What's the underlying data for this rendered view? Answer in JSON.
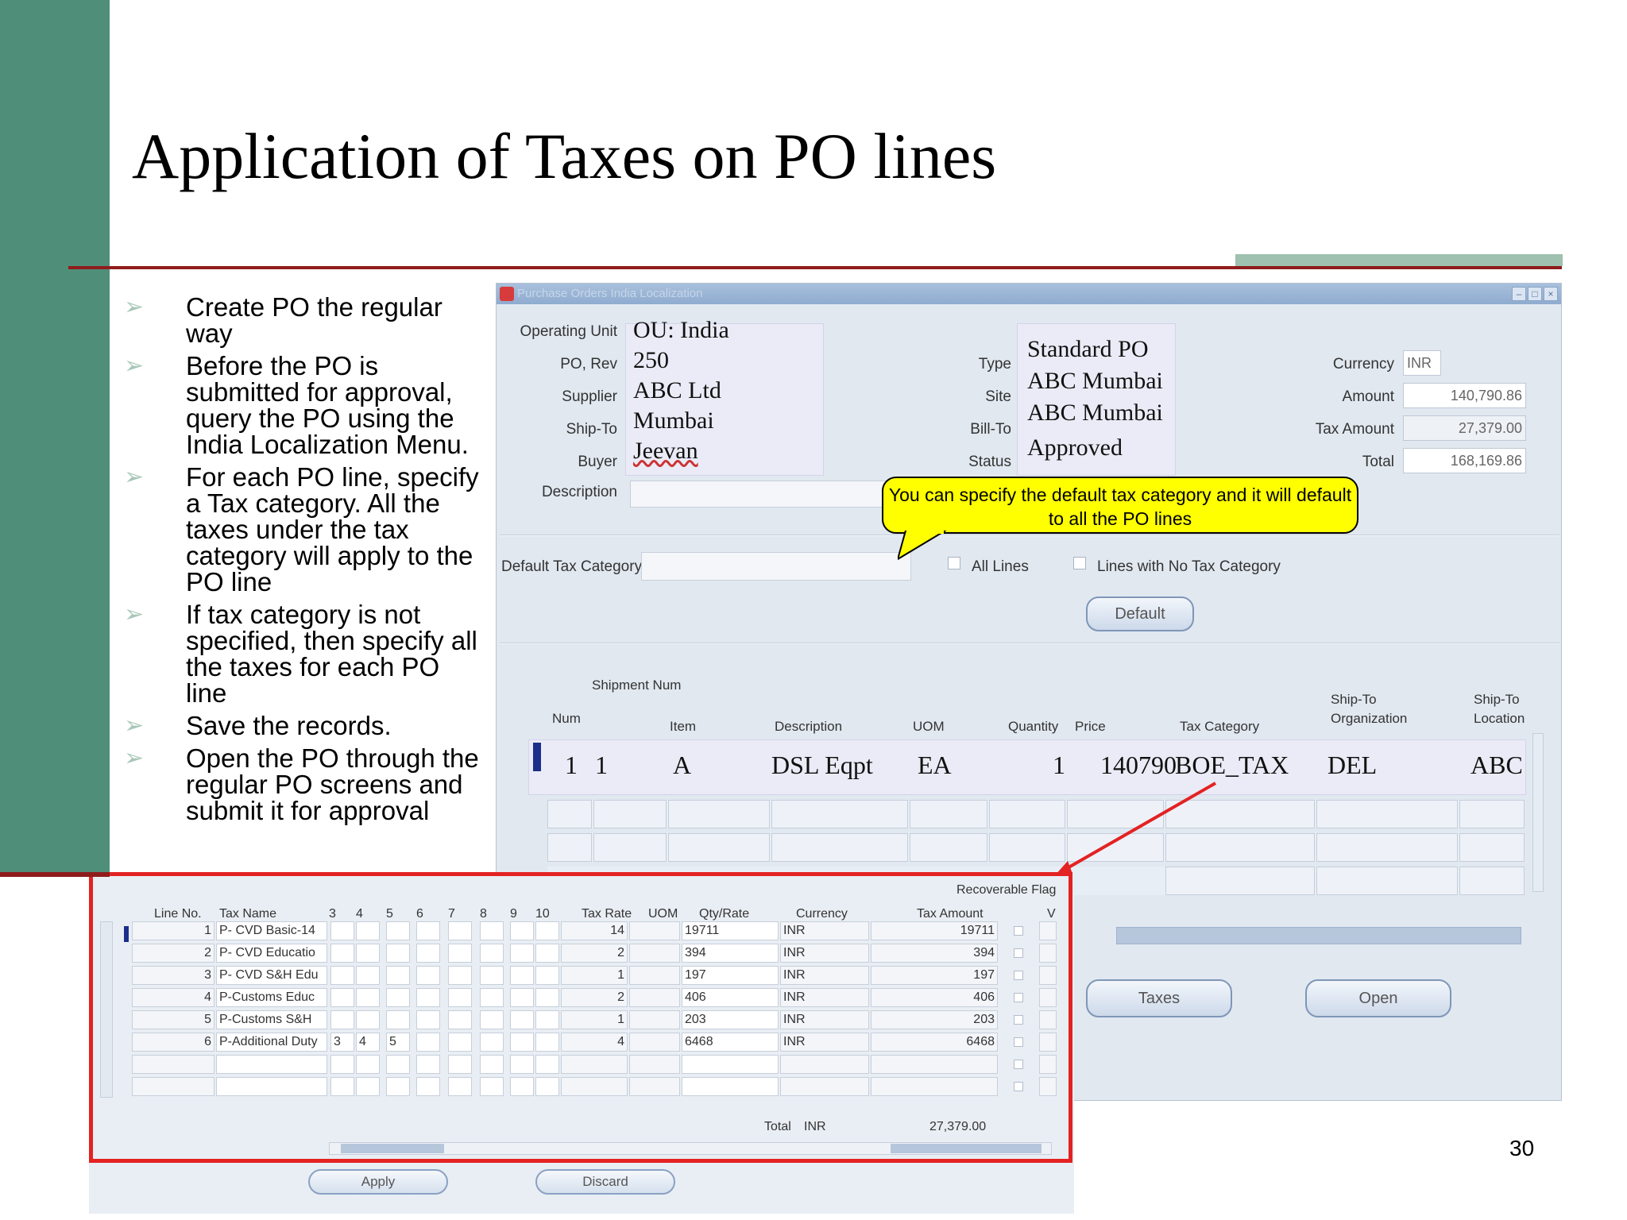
{
  "slide": {
    "title": "Application of Taxes on PO lines",
    "page_number": "30",
    "bullets": [
      "Create PO the regular way",
      "Before the PO is submitted for approval, query the PO using the India Localization Menu.",
      "For each PO line, specify a Tax category. All the taxes under the tax category will apply to the PO line",
      "If tax category is not specified, then specify all the taxes for each PO line",
      "Save the records.",
      "Open the PO through the regular PO screens and submit it for approval"
    ]
  },
  "window": {
    "title": "Purchase Orders India Localization",
    "header": {
      "labels": {
        "operating_unit": "Operating Unit",
        "po_rev": "PO, Rev",
        "supplier": "Supplier",
        "ship_to": "Ship-To",
        "buyer": "Buyer",
        "description": "Description",
        "type": "Type",
        "site": "Site",
        "bill_to": "Bill-To",
        "status": "Status",
        "currency": "Currency",
        "amount": "Amount",
        "tax_amount": "Tax Amount",
        "total": "Total"
      },
      "values": {
        "operating_unit": "OU: India",
        "po_rev": "250",
        "supplier": "ABC Ltd",
        "ship_to": "Mumbai",
        "buyer": "Jeevan",
        "type": "Standard PO",
        "site": "ABC Mumbai",
        "bill_to": "ABC Mumbai",
        "status": "Approved",
        "currency": "INR",
        "amount": "140,790.86",
        "tax_amount": "27,379.00",
        "total": "168,169.86"
      }
    },
    "default_tax": {
      "label": "Default Tax Category",
      "all_lines": "All Lines",
      "lines_no_tax": "Lines with No Tax Category",
      "default_button": "Default"
    },
    "callout": "You can specify the default tax category and it will default to all the PO lines",
    "lines": {
      "headers": {
        "shipment_num": "Shipment Num",
        "num": "Num",
        "item": "Item",
        "description": "Description",
        "uom": "UOM",
        "quantity": "Quantity",
        "price": "Price",
        "tax_category": "Tax Category",
        "ship_to_org": "Ship-To Organization",
        "ship_to_loc": "Ship-To Location"
      },
      "row": {
        "num": "1",
        "shipment": "1",
        "item": "A",
        "description": "DSL Eqpt",
        "uom": "EA",
        "quantity": "1",
        "price": "140790",
        "tax_category": "BOE_TAX",
        "ship_to_org": "DEL",
        "ship_to_loc": "ABC"
      }
    },
    "buttons": {
      "taxes": "Taxes",
      "open": "Open"
    }
  },
  "tax_detail": {
    "recoverable_flag": "Recoverable Flag",
    "headers": {
      "line_no": "Line No.",
      "tax_name": "Tax Name",
      "cols": [
        "3",
        "4",
        "5",
        "6",
        "7",
        "8",
        "9",
        "10"
      ],
      "tax_rate": "Tax Rate",
      "uom": "UOM",
      "qty_rate": "Qty/Rate",
      "currency": "Currency",
      "tax_amount": "Tax Amount",
      "v": "V"
    },
    "rows": [
      {
        "line": "1",
        "name": "P- CVD Basic-14",
        "c3": "",
        "c4": "",
        "c5": "",
        "rate": "14",
        "qty": "19711",
        "cur": "INR",
        "amt": "19711"
      },
      {
        "line": "2",
        "name": "P- CVD Educatio",
        "c3": "",
        "c4": "",
        "c5": "",
        "rate": "2",
        "qty": "394",
        "cur": "INR",
        "amt": "394"
      },
      {
        "line": "3",
        "name": "P- CVD S&H Edu",
        "c3": "",
        "c4": "",
        "c5": "",
        "rate": "1",
        "qty": "197",
        "cur": "INR",
        "amt": "197"
      },
      {
        "line": "4",
        "name": "P-Customs Educ",
        "c3": "",
        "c4": "",
        "c5": "",
        "rate": "2",
        "qty": "406",
        "cur": "INR",
        "amt": "406"
      },
      {
        "line": "5",
        "name": "P-Customs S&H",
        "c3": "",
        "c4": "",
        "c5": "",
        "rate": "1",
        "qty": "203",
        "cur": "INR",
        "amt": "203"
      },
      {
        "line": "6",
        "name": "P-Additional Duty",
        "c3": "3",
        "c4": "4",
        "c5": "5",
        "rate": "4",
        "qty": "6468",
        "cur": "INR",
        "amt": "6468"
      }
    ],
    "total_label": "Total",
    "total_currency": "INR",
    "total_amount": "27,379.00",
    "apply_button": "Apply",
    "discard_button": "Discard"
  }
}
